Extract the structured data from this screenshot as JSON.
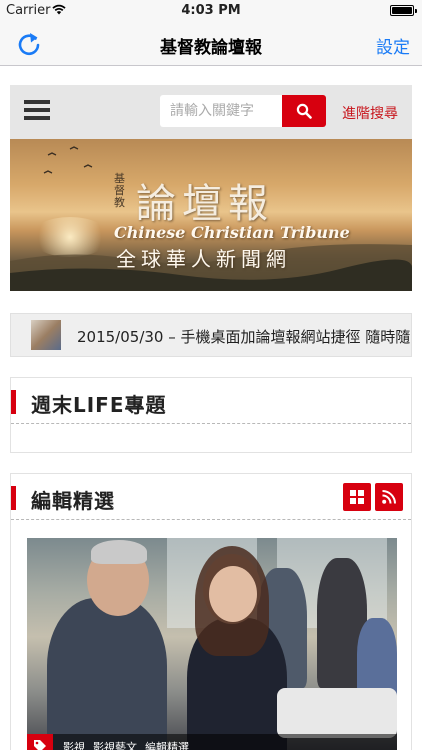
{
  "status_bar": {
    "carrier": "Carrier",
    "time": "4:03 PM",
    "wifi_icon": "wifi-icon",
    "battery_level": 1.0
  },
  "nav": {
    "reload_icon": "reload-icon",
    "title": "基督教論壇報",
    "settings_label": "設定"
  },
  "site_header": {
    "menu_icon": "hamburger-icon",
    "search_placeholder": "請輸入關鍵字",
    "search_icon": "search-icon",
    "advanced_search_label": "進階搜尋"
  },
  "banner": {
    "logo_small": "基督教",
    "logo_main": "論壇報",
    "logo_en": "Chinese Christian Tribune",
    "logo_sub": "全球華人新聞網"
  },
  "ticker": {
    "text": "2015/05/30 – 手機桌面加論壇報網站捷徑 隨時隨"
  },
  "sections": {
    "weekend": {
      "title": "週末LIFE專題"
    },
    "editors_pick": {
      "title": "編輯精選",
      "grid_icon": "grid-icon",
      "rss_icon": "rss-icon",
      "tags": [
        "影視",
        "影視藝文",
        "編輯精選"
      ]
    }
  },
  "colors": {
    "accent_red": "#d7000f",
    "link_blue": "#1a7bf6",
    "advanced_link_red": "#c8161d"
  }
}
